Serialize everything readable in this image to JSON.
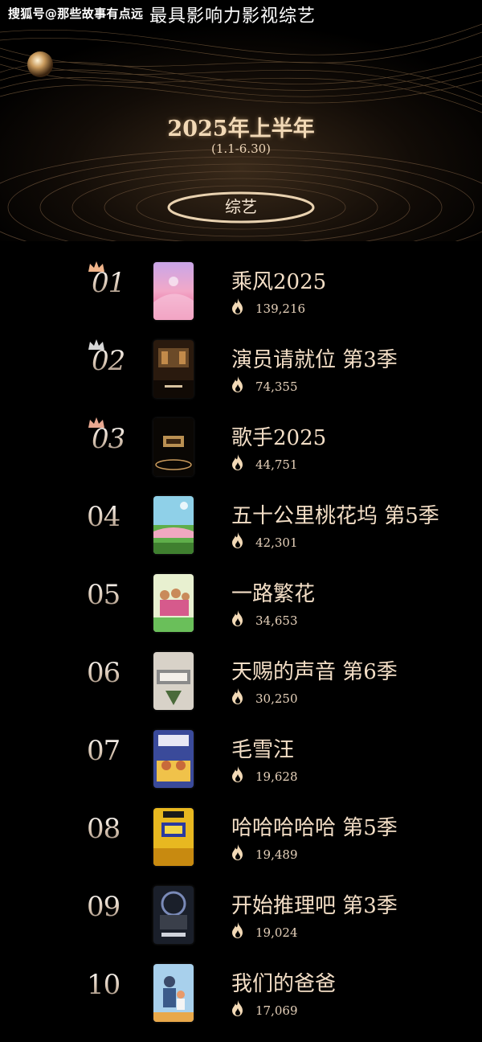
{
  "watermark": "搜狐号@那些故事有点远",
  "header": {
    "title": "最具影响力影视综艺",
    "period": "2025年上半年",
    "range": "(1.1-6.30)",
    "category": "综艺"
  },
  "ranking": [
    {
      "rank": "01",
      "name": "乘风2025",
      "heat": "139,216",
      "crown": "gold"
    },
    {
      "rank": "02",
      "name": "演员请就位 第3季",
      "heat": "74,355",
      "crown": "silver"
    },
    {
      "rank": "03",
      "name": "歌手2025",
      "heat": "44,751",
      "crown": "bronze"
    },
    {
      "rank": "04",
      "name": "五十公里桃花坞 第5季",
      "heat": "42,301"
    },
    {
      "rank": "05",
      "name": "一路繁花",
      "heat": "34,653"
    },
    {
      "rank": "06",
      "name": "天赐的声音 第6季",
      "heat": "30,250"
    },
    {
      "rank": "07",
      "name": "毛雪汪",
      "heat": "19,628"
    },
    {
      "rank": "08",
      "name": "哈哈哈哈哈 第5季",
      "heat": "19,489"
    },
    {
      "rank": "09",
      "name": "开始推理吧 第3季",
      "heat": "19,024"
    },
    {
      "rank": "10",
      "name": "我们的爸爸",
      "heat": "17,069"
    }
  ],
  "icons": {
    "heat": "flame-icon",
    "crown": "crown-icon"
  },
  "colors": {
    "background": "#000000",
    "accent_gold": "#f2d9b6",
    "crown_gold": "#f0b48a",
    "crown_silver": "#d8d8d8",
    "crown_bronze": "#e8a890"
  }
}
